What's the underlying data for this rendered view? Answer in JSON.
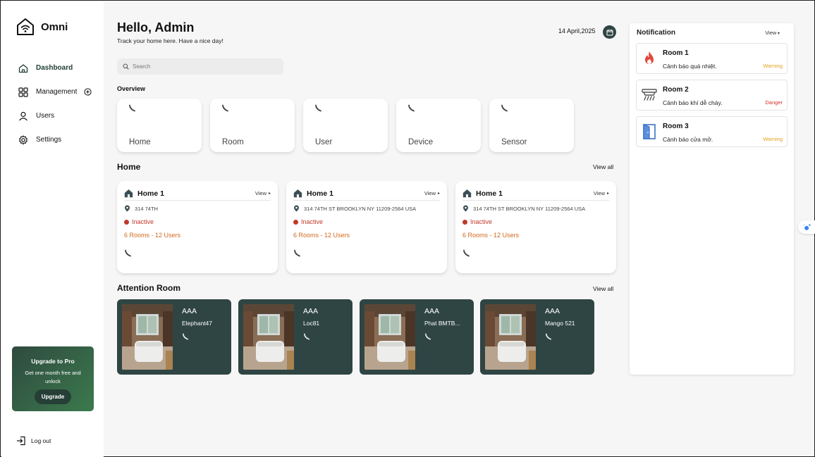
{
  "app": {
    "name": "Omni"
  },
  "sidebar": {
    "items": [
      {
        "label": "Dashboard",
        "icon": "home-icon",
        "active": true
      },
      {
        "label": "Management",
        "icon": "grid-icon"
      },
      {
        "label": "Users",
        "icon": "user-icon"
      },
      {
        "label": "Settings",
        "icon": "gear-icon"
      }
    ],
    "upgrade": {
      "title": "Upgrade to Pro",
      "description": "Get one month free and unlock",
      "button": "Upgrade"
    },
    "logout": "Log out"
  },
  "header": {
    "greeting": "Hello, Admin",
    "subtitle": "Track your home here. Have a nice day!",
    "date": "14 April,2025"
  },
  "search": {
    "placeholder": "Search"
  },
  "overview": {
    "label": "Overview",
    "cards": [
      {
        "label": "Home"
      },
      {
        "label": "Room"
      },
      {
        "label": "User"
      },
      {
        "label": "Device"
      },
      {
        "label": "Sensor"
      }
    ]
  },
  "homes": {
    "title": "Home",
    "view_all": "View all",
    "cards": [
      {
        "name": "Home 1",
        "view": "View",
        "address": "314 74TH",
        "status": "Inactive",
        "counts": "6 Rooms - 12 Users"
      },
      {
        "name": "Home 1",
        "view": "View",
        "address": "314 74TH ST BROOKLYN NY 11209-2564 USA",
        "status": "Inactive",
        "counts": "6 Rooms - 12 Users"
      },
      {
        "name": "Home 1",
        "view": "View",
        "address": "314 74TH ST BROOKLYN NY 11209-2564 USA",
        "status": "Inactive",
        "counts": "6 Rooms - 12 Users"
      }
    ]
  },
  "attention": {
    "title": "Attention Room",
    "view_all": "View all",
    "rooms": [
      {
        "title": "AAA",
        "name": "Elephant47"
      },
      {
        "title": "AAA",
        "name": "Loc81"
      },
      {
        "title": "AAA",
        "name": "Phat BMTB..."
      },
      {
        "title": "AAA",
        "name": "Mango 521"
      }
    ]
  },
  "notification": {
    "title": "Notification",
    "view": "View",
    "items": [
      {
        "room": "Room 1",
        "message": "Cảnh báo quá nhiệt.",
        "level": "Warning",
        "icon": "fire-icon"
      },
      {
        "room": "Room 2",
        "message": "Cảnh báo khí dễ cháy.",
        "level": "Danger",
        "icon": "gas-sensor-icon"
      },
      {
        "room": "Room 3",
        "message": "Cảnh báo cửa mở.",
        "level": "Warning",
        "icon": "door-open-icon"
      }
    ]
  },
  "colors": {
    "accent": "#2f4544",
    "warning": "#e4a11b",
    "danger": "#d63030",
    "inactive": "#c0392b",
    "counts": "#d2691e"
  }
}
